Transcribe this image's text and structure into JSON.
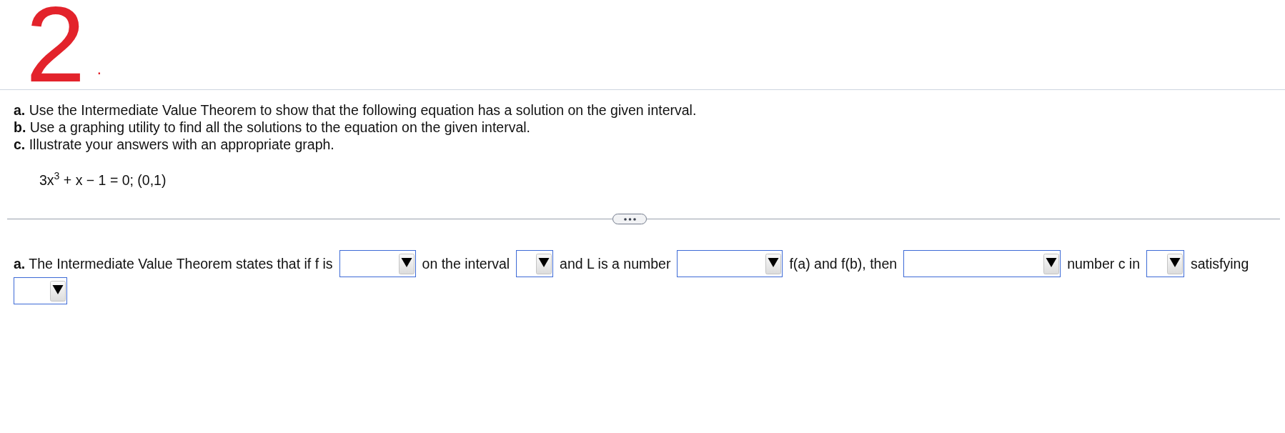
{
  "annotation": {
    "number": "2",
    "dot": "."
  },
  "instructions": [
    "**a.** Use the Intermediate Value Theorem to show that the following equation has a solution on the given interval.",
    "**b.** Use a graphing utility to find all the solutions to the equation on the given interval.",
    "**c.** Illustrate your answers with an appropriate graph."
  ],
  "equation": "3x$^{3}$ + x − 1 = 0; (0,1)",
  "part_a": {
    "segments": [
      {
        "kind": "text",
        "text": "**a.** The Intermediate Value Theorem states that if f is"
      },
      {
        "kind": "dropdown"
      },
      {
        "kind": "text",
        "text": "on the interval"
      },
      {
        "kind": "dropdown"
      },
      {
        "kind": "text",
        "text": "and L is a number"
      },
      {
        "kind": "dropdown"
      },
      {
        "kind": "text",
        "text": "f(a) and f(b), then"
      },
      {
        "kind": "dropdown"
      },
      {
        "kind": "text",
        "text": "number c in"
      },
      {
        "kind": "dropdown"
      },
      {
        "kind": "text",
        "text": "satisfying"
      },
      {
        "kind": "dropdown"
      }
    ]
  }
}
